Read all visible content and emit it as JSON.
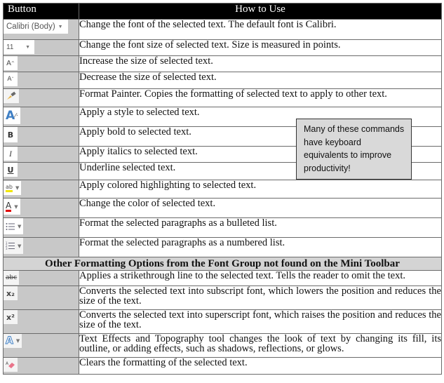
{
  "header": {
    "col_button": "Button",
    "col_how": "How to Use"
  },
  "rows": [
    {
      "icon": "font-name-dropdown",
      "icon_text": "Calibri (Body)",
      "description": "Change the font of the selected text. The default font is Calibri."
    },
    {
      "icon": "font-size-dropdown",
      "icon_text": "11",
      "description": "Change the font size of selected text. Size is measured in points."
    },
    {
      "icon": "grow-font-icon",
      "icon_text": "A˄",
      "description": "Increase the size of selected text."
    },
    {
      "icon": "shrink-font-icon",
      "icon_text": "A˅",
      "description": "Decrease the size of selected text."
    },
    {
      "icon": "format-painter-icon",
      "icon_text": "",
      "description": "Format Painter. Copies the formatting of selected text to apply to other text."
    },
    {
      "icon": "styles-icon",
      "icon_text": "A",
      "description": "Apply a style to selected text."
    },
    {
      "icon": "bold-icon",
      "icon_text": "B",
      "description": "Apply bold to selected text."
    },
    {
      "icon": "italic-icon",
      "icon_text": "I",
      "description": "Apply italics to selected text."
    },
    {
      "icon": "underline-icon",
      "icon_text": "U",
      "description": "Underline selected text."
    },
    {
      "icon": "highlight-icon",
      "icon_text": "ab",
      "description": "Apply colored highlighting to selected text."
    },
    {
      "icon": "font-color-icon",
      "icon_text": "A",
      "description": "Change the color of selected text."
    },
    {
      "icon": "bullets-icon",
      "icon_text": "",
      "description": "Format the selected paragraphs as a bulleted list."
    },
    {
      "icon": "numbering-icon",
      "icon_text": "",
      "description": "Format the selected paragraphs as a numbered list."
    }
  ],
  "section_title": "Other Formatting Options from the Font Group not found on the Mini Toolbar",
  "other_rows": [
    {
      "icon": "strikethrough-icon",
      "icon_text": "abc",
      "description": "Applies a strikethrough line to the selected text. Tells the reader to omit the text."
    },
    {
      "icon": "subscript-icon",
      "icon_text": "x₂",
      "description": "Converts the selected text into subscript font, which lowers the position and reduces the size of the text."
    },
    {
      "icon": "superscript-icon",
      "icon_text": "x²",
      "description": "Converts the selected text into superscript font, which raises the position and reduces the size of the text."
    },
    {
      "icon": "text-effects-icon",
      "icon_text": "A",
      "description": "Text Effects and Topography tool changes the look of text by changing its fill, its outline, or adding effects, such as shadows, reflections, or glows."
    },
    {
      "icon": "clear-formatting-icon",
      "icon_text": "",
      "description": "Clears the formatting of the selected text."
    }
  ],
  "callout": {
    "text": "Many of these commands have keyboard equivalents to improve productivity!"
  },
  "colors": {
    "header_bg": "#000000",
    "button_col_bg": "#c8c8c8",
    "section_bg": "#d4d4d4",
    "callout_bg": "#d9d9d9",
    "highlight_yellow": "#f2e600",
    "font_color_red": "#e00000",
    "styles_blue": "#3f7fc4"
  }
}
